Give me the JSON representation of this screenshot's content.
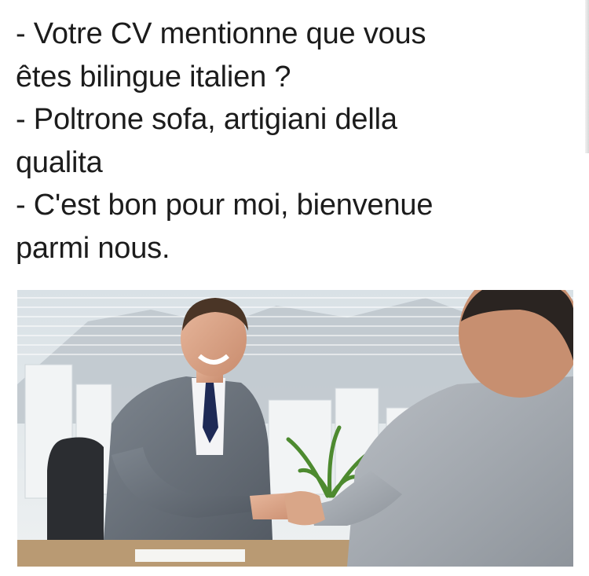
{
  "caption": {
    "lines": [
      "- Votre CV mentionne que vous",
      "êtes bilingue italien ?",
      "- Poltrone sofa, artigiani della",
      "qualita",
      "- C'est bon pour moi, bienvenue",
      "parmi nous."
    ]
  },
  "photo": {
    "subject": "handshake-job-interview"
  }
}
